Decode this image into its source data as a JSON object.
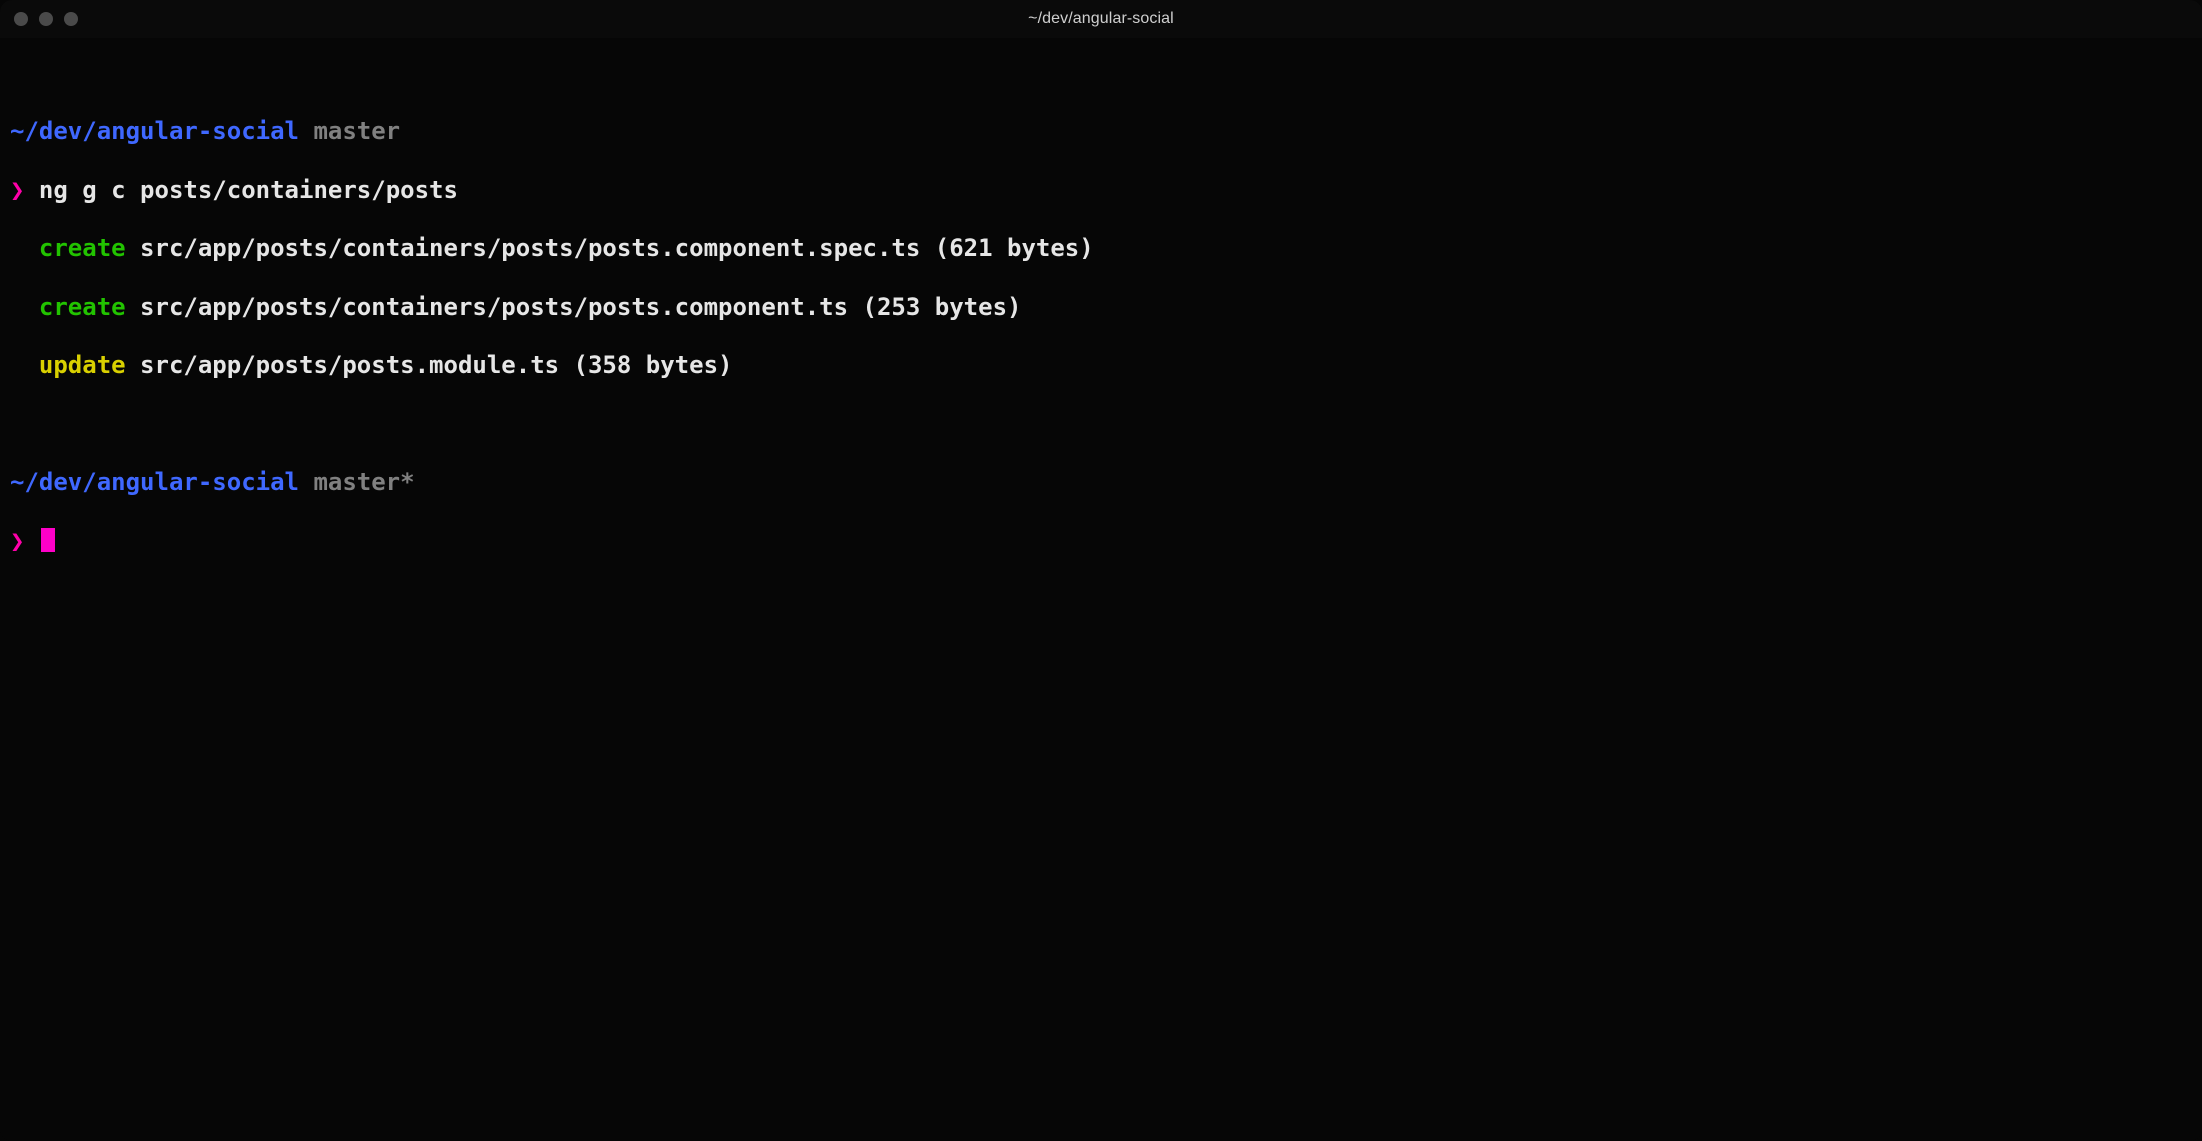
{
  "window": {
    "title": "~/dev/angular-social"
  },
  "prompt_char": "❯",
  "prompt1": {
    "cwd": "~/dev/angular-social",
    "branch": "master",
    "command": "ng g c posts/containers/posts"
  },
  "output": [
    {
      "indent": "  ",
      "action": "create",
      "rest": " src/app/posts/containers/posts/posts.component.spec.ts (621 bytes)"
    },
    {
      "indent": "  ",
      "action": "create",
      "rest": " src/app/posts/containers/posts/posts.component.ts (253 bytes)"
    },
    {
      "indent": "  ",
      "action": "update",
      "rest": " src/app/posts/posts.module.ts (358 bytes)"
    }
  ],
  "prompt2": {
    "cwd": "~/dev/angular-social",
    "branch": "master*"
  }
}
